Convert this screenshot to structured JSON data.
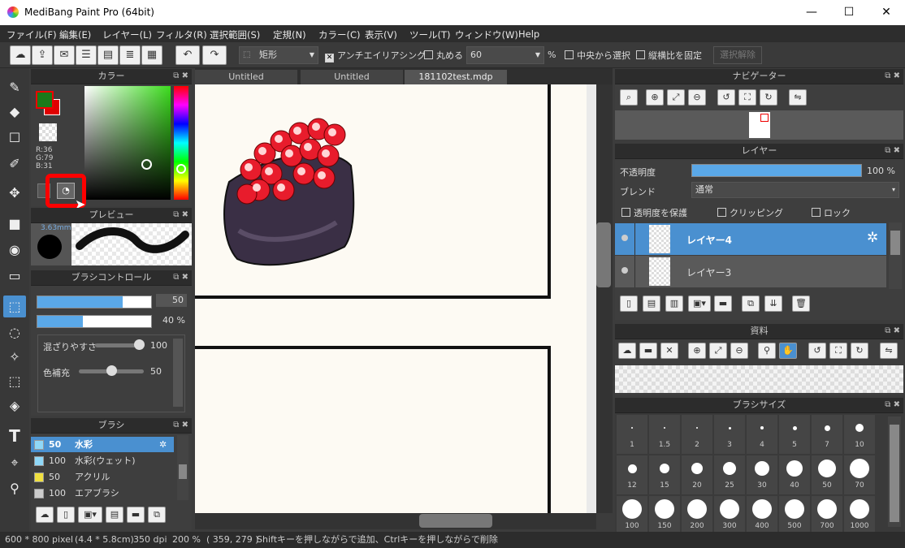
{
  "window": {
    "title": "MediBang Paint Pro (64bit)",
    "minimize": "—",
    "maximize": "☐",
    "close": "✕"
  },
  "menu": [
    "ファイル(F)",
    "編集(E)",
    "レイヤー(L)",
    "フィルタ(R)",
    "選択範囲(S)",
    "定規(N)",
    "カラー(C)",
    "表示(V)",
    "ツール(T)",
    "ウィンドウ(W)",
    "Help"
  ],
  "toolbar": {
    "shape_select": "矩形",
    "antialias": "アンチエイリアシング",
    "round": "丸める",
    "round_value": "60",
    "percent": "%",
    "from_center": "中央から選択",
    "fix_ratio": "縦横比を固定",
    "deselect": "選択解除"
  },
  "color_panel": {
    "title": "カラー",
    "r": "R:36",
    "g": "G:79",
    "b": "B:31",
    "fg_color": "#1a7a1a",
    "bg_color": "#e00000"
  },
  "preview_panel": {
    "title": "プレビュー",
    "size": "3.63mm"
  },
  "brush_control": {
    "title": "ブラシコントロール",
    "size_value": "50",
    "opacity_value": "40 %",
    "mix_label": "混ざりやすさ",
    "mix_value": "100",
    "fill_label": "色補充",
    "fill_value": "50"
  },
  "brush_panel": {
    "title": "ブラシ",
    "items": [
      {
        "size": "50",
        "name": "水彩",
        "color": "#8fd8f8"
      },
      {
        "size": "100",
        "name": "水彩(ウェット)",
        "color": "#8fd8f8"
      },
      {
        "size": "50",
        "name": "アクリル",
        "color": "#f0e040"
      },
      {
        "size": "100",
        "name": "エアブラシ",
        "color": "#cccccc"
      }
    ]
  },
  "tabs": [
    "Untitled",
    "Untitled",
    "181102test.mdp"
  ],
  "navigator": {
    "title": "ナビゲーター"
  },
  "layer_panel": {
    "title": "レイヤー",
    "opacity_label": "不透明度",
    "opacity_value": "100 %",
    "opacity_fraction": 1.0,
    "blend_label": "ブレンド",
    "blend_value": "通常",
    "protect_alpha": "透明度を保護",
    "clipping": "クリッピング",
    "lock": "ロック",
    "layers": [
      {
        "name": "レイヤー4",
        "selected": true
      },
      {
        "name": "レイヤー3",
        "selected": false
      }
    ]
  },
  "material_panel": {
    "title": "資料"
  },
  "brush_size_panel": {
    "title": "ブラシサイズ",
    "sizes": [
      "1",
      "1.5",
      "2",
      "3",
      "4",
      "5",
      "7",
      "10",
      "12",
      "15",
      "20",
      "25",
      "30",
      "40",
      "50",
      "70",
      "100",
      "150",
      "200",
      "300",
      "400",
      "500",
      "700",
      "1000"
    ]
  },
  "status": {
    "dims": "600 * 800 pixel",
    "cm": "(4.4 * 5.8cm)",
    "dpi": "350 dpi",
    "zoom": "200 %",
    "coords": "( 359, 279 )",
    "hint": "Shiftキーを押しながらで追加、Ctrlキーを押しながらで削除"
  },
  "accent": "#4a90d0",
  "highlight": "#ff0000"
}
